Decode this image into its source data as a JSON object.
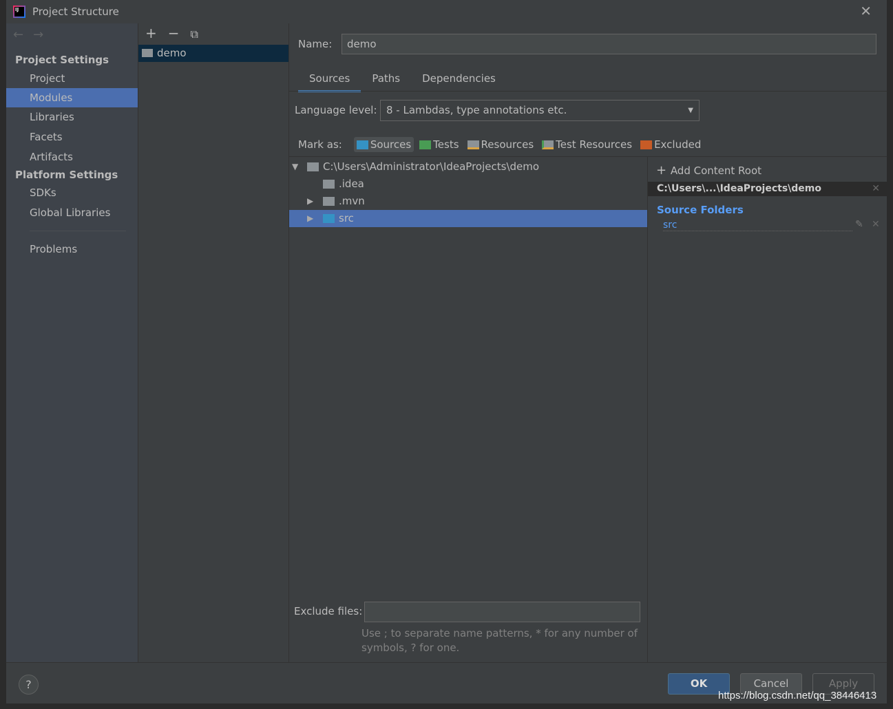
{
  "window": {
    "title": "Project Structure"
  },
  "sidebar": {
    "project_settings": "Project Settings",
    "platform_settings": "Platform Settings",
    "items": [
      {
        "label": "Project"
      },
      {
        "label": "Modules"
      },
      {
        "label": "Libraries"
      },
      {
        "label": "Facets"
      },
      {
        "label": "Artifacts"
      }
    ],
    "platform_items": [
      {
        "label": "SDKs"
      },
      {
        "label": "Global Libraries"
      }
    ],
    "problems": "Problems"
  },
  "modules": {
    "items": [
      {
        "label": "demo"
      }
    ]
  },
  "main": {
    "name_label": "Name:",
    "name_value": "demo",
    "tabs": [
      {
        "label": "Sources"
      },
      {
        "label": "Paths"
      },
      {
        "label": "Dependencies"
      }
    ],
    "language_level_label": "Language level:",
    "language_level_value": "8 - Lambdas, type annotations etc.",
    "mark_as_label": "Mark as:",
    "mark_as": [
      {
        "label": "Sources",
        "color": "#3592c4"
      },
      {
        "label": "Tests",
        "color": "#499c54"
      },
      {
        "label": "Resources",
        "color": "#8c9296"
      },
      {
        "label": "Test Resources",
        "color": "#8c9296"
      },
      {
        "label": "Excluded",
        "color": "#c75b26"
      }
    ],
    "tree": [
      {
        "label": "C:\\Users\\Administrator\\IdeaProjects\\demo",
        "expanded": true
      },
      {
        "label": ".idea"
      },
      {
        "label": ".mvn",
        "expandable": true
      },
      {
        "label": "src",
        "expandable": true,
        "selected": true
      }
    ],
    "exclude_label": "Exclude files:",
    "exclude_value": "",
    "exclude_hint_1": "Use ; to separate name patterns, * for any number of",
    "exclude_hint_2": "symbols, ? for one."
  },
  "content_root": {
    "add_label": "Add Content Root",
    "path": "C:\\Users\\...\\IdeaProjects\\demo",
    "source_folders_label": "Source Folders",
    "source_folders": [
      {
        "label": "src"
      }
    ]
  },
  "footer": {
    "help": "?",
    "ok": "OK",
    "cancel": "Cancel",
    "apply": "Apply"
  },
  "watermark": "https://blog.csdn.net/qq_38446413"
}
